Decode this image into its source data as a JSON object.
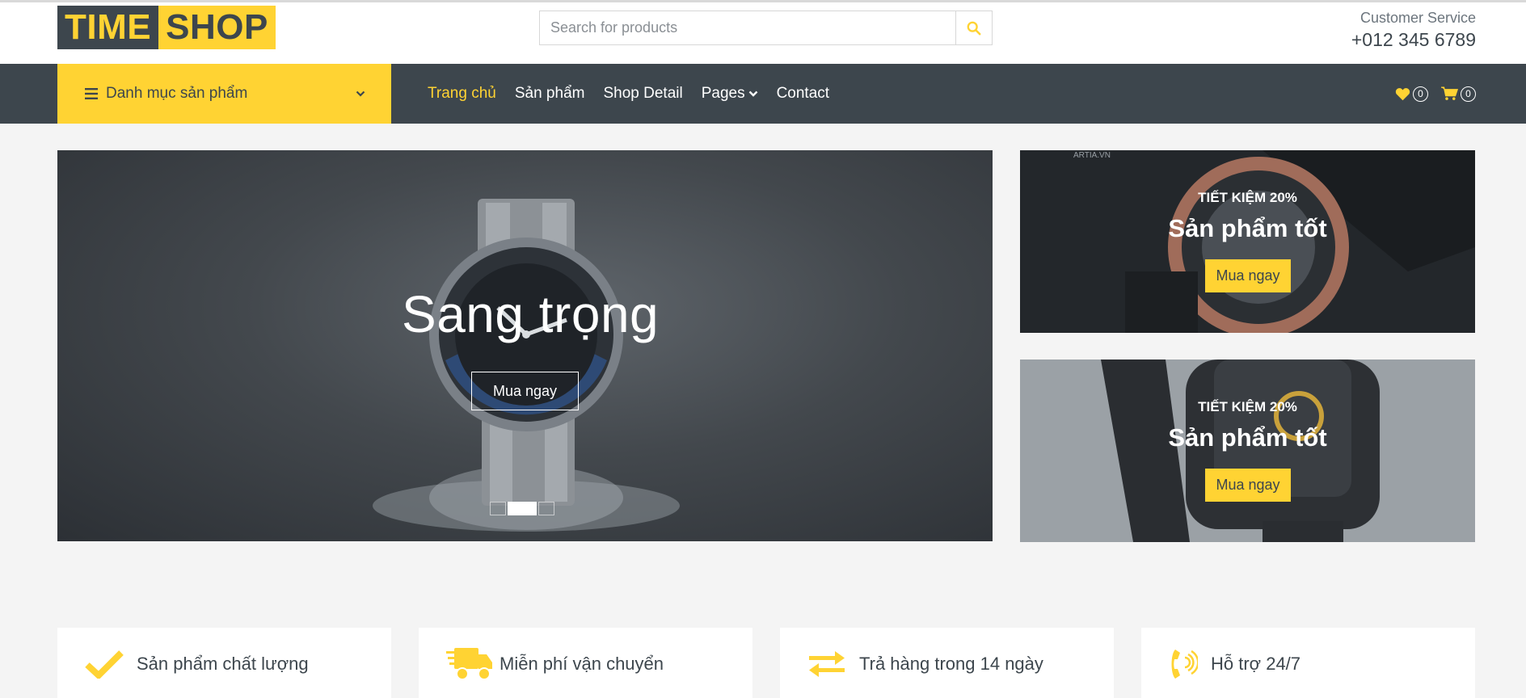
{
  "brand": {
    "part1": "TIME",
    "part2": "SHOP"
  },
  "search": {
    "placeholder": "Search for products",
    "icon": "search-icon"
  },
  "customer_service": {
    "label": "Customer Service",
    "phone": "+012 345 6789"
  },
  "category": {
    "label": "Danh mục sản phẩm",
    "icon": "bars-icon",
    "chevron": "chevron-down-icon"
  },
  "nav": {
    "items": [
      {
        "label": "Trang chủ",
        "active": true
      },
      {
        "label": "Sản phẩm"
      },
      {
        "label": "Shop Detail"
      },
      {
        "label": "Pages",
        "has_dropdown": true
      },
      {
        "label": "Contact"
      }
    ],
    "wishlist_count": "0",
    "cart_count": "0"
  },
  "hero": {
    "title": "Sang trọng",
    "button": "Mua ngay",
    "slide_count": 3,
    "active_slide": 2
  },
  "offers": [
    {
      "subtitle": "TIẾT KIỆM 20%",
      "title": "Sản phẩm tốt",
      "button": "Mua ngay",
      "watermark": "ARTIA.VN"
    },
    {
      "subtitle": "TIẾT KIỆM 20%",
      "title": "Sản phẩm tốt",
      "button": "Mua ngay"
    }
  ],
  "features": [
    {
      "label": "Sản phẩm chất lượng",
      "icon": "check-icon"
    },
    {
      "label": "Miễn phí vận chuyển",
      "icon": "shipping-fast-icon"
    },
    {
      "label": "Trả hàng trong 14 ngày",
      "icon": "exchange-icon"
    },
    {
      "label": "Hỗ trợ 24/7",
      "icon": "phone-volume-icon"
    }
  ],
  "colors": {
    "primary": "#ffd333",
    "dark": "#3d464d",
    "background": "#f4f4f4"
  }
}
